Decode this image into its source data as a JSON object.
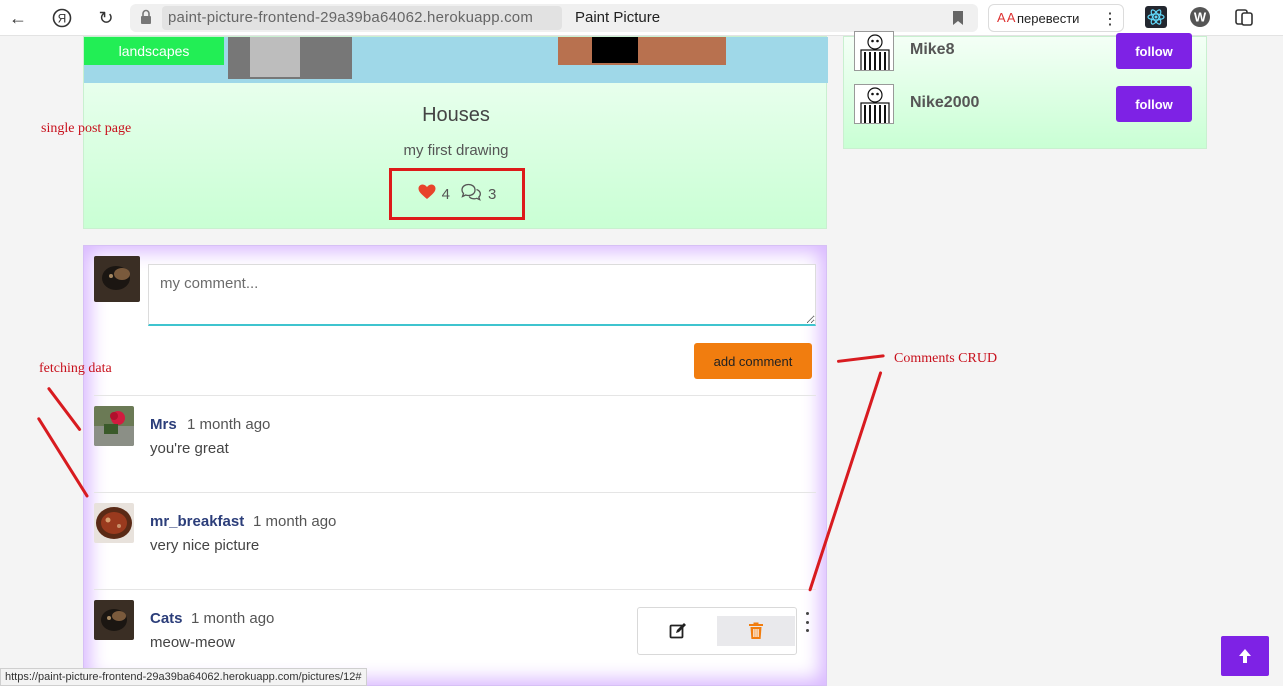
{
  "browser": {
    "url": "paint-picture-frontend-29a39ba64062.herokuapp.com",
    "title": "Paint Picture",
    "translate_label": "перевести",
    "status_url": "https://paint-picture-frontend-29a39ba64062.herokuapp.com/pictures/12#"
  },
  "post": {
    "category": "landscapes",
    "title": "Houses",
    "description": "my first drawing",
    "likes": "4",
    "comments_count": "3"
  },
  "comment_form": {
    "placeholder": "my comment...",
    "submit_label": "add comment"
  },
  "comments": [
    {
      "owner": "Mrs",
      "date": "1 month ago",
      "content": "you're great"
    },
    {
      "owner": "mr_breakfast",
      "date": "1 month ago",
      "content": "very nice picture"
    },
    {
      "owner": "Cats",
      "date": "1 month ago",
      "content": "meow-meow"
    }
  ],
  "profiles": [
    {
      "name": "Mike8",
      "follow_label": "follow"
    },
    {
      "name": "Nike2000",
      "follow_label": "follow"
    }
  ],
  "annotations": {
    "single_post": "single post page",
    "fetching": "fetching data",
    "crud": "Comments CRUD"
  },
  "colors": {
    "accent_purple": "#7e22e5",
    "accent_orange": "#f17d0f",
    "heart_red": "#e8432b",
    "annotation_red": "#c8101c"
  }
}
